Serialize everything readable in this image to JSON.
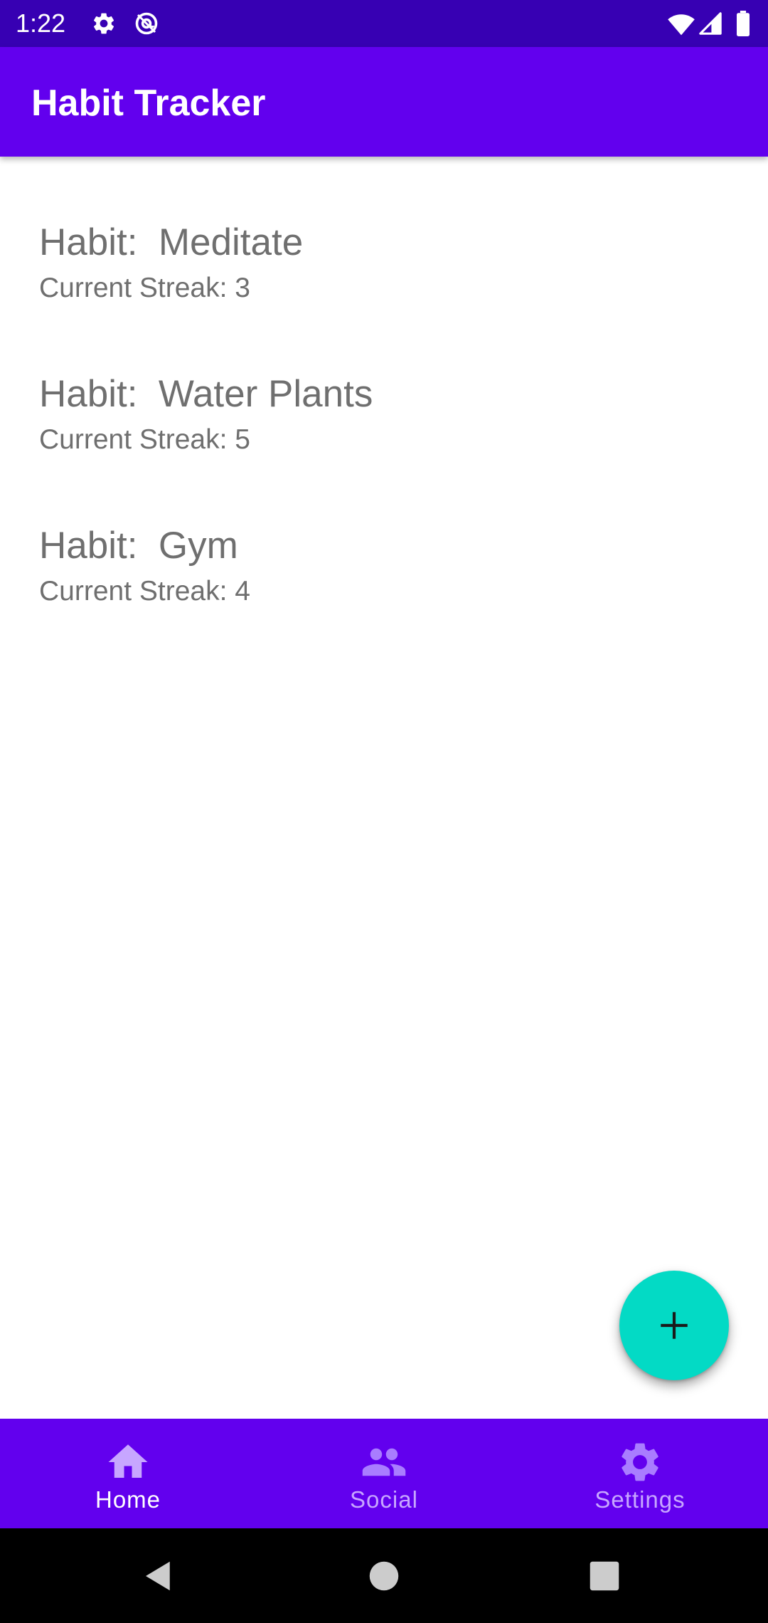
{
  "status_bar": {
    "time": "1:22",
    "icons": [
      "gear-icon",
      "at-sign-icon",
      "wifi-icon",
      "signal-icon",
      "battery-icon"
    ]
  },
  "app_bar": {
    "title": "Habit Tracker"
  },
  "habits": [
    {
      "name": "Habit:  Meditate",
      "streak": "Current Streak: 3"
    },
    {
      "name": "Habit:  Water Plants",
      "streak": "Current Streak: 5"
    },
    {
      "name": "Habit:  Gym",
      "streak": "Current Streak: 4"
    }
  ],
  "fab": {
    "icon": "plus-icon"
  },
  "bottom_nav": {
    "items": [
      {
        "label": "Home",
        "icon": "home-icon",
        "active": true
      },
      {
        "label": "Social",
        "icon": "people-icon",
        "active": false
      },
      {
        "label": "Settings",
        "icon": "gear-icon",
        "active": false
      }
    ]
  },
  "system_nav": {
    "icons": [
      "back-icon",
      "home-circle-icon",
      "recents-icon"
    ]
  },
  "colors": {
    "primary": "#6200EE",
    "primary_dark": "#3700B3",
    "accent": "#03DAC5",
    "text_secondary": "#6f6f6f",
    "nav_inactive": "#c7a6ff"
  }
}
